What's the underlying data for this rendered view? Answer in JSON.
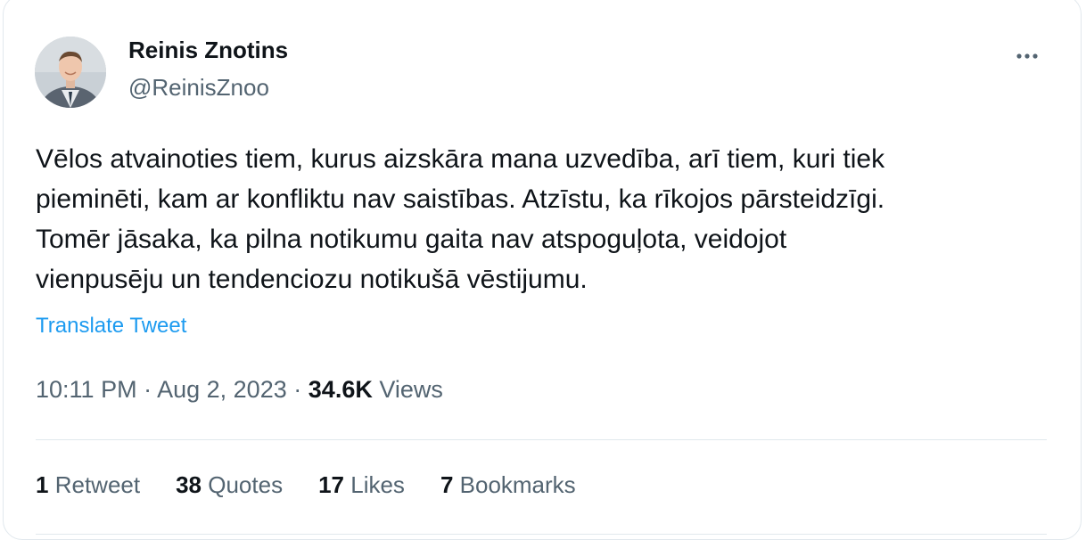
{
  "author": {
    "name": "Reinis Znotins",
    "handle": "@ReinisZnoo"
  },
  "tweet": {
    "lines": [
      "Vēlos atvainoties tiem, kurus aizskāra mana uzvedība, arī tiem, kuri tiek",
      "pieminēti, kam ar konfliktu nav saistības. Atzīstu, ka rīkojos pārsteidzīgi.",
      "Tomēr jāsaka, ka pilna notikumu gaita nav atspoguļota, veidojot",
      "vienpusēju un tendenciozu notikušā vēstijumu."
    ],
    "translate_label": "Translate Tweet"
  },
  "meta": {
    "time": "10:11 PM",
    "separator": "·",
    "date": "Aug 2, 2023",
    "views_count": "34.6K",
    "views_label": "Views"
  },
  "stats": {
    "retweets": {
      "count": "1",
      "label": "Retweet"
    },
    "quotes": {
      "count": "38",
      "label": "Quotes"
    },
    "likes": {
      "count": "17",
      "label": "Likes"
    },
    "bookmarks": {
      "count": "7",
      "label": "Bookmarks"
    }
  },
  "icons": {
    "more": "more-options-icon",
    "avatar": "profile-photo"
  },
  "colors": {
    "text_primary": "#0f1419",
    "text_secondary": "#536471",
    "link": "#1d9bf0",
    "border": "#e1e8ed"
  }
}
